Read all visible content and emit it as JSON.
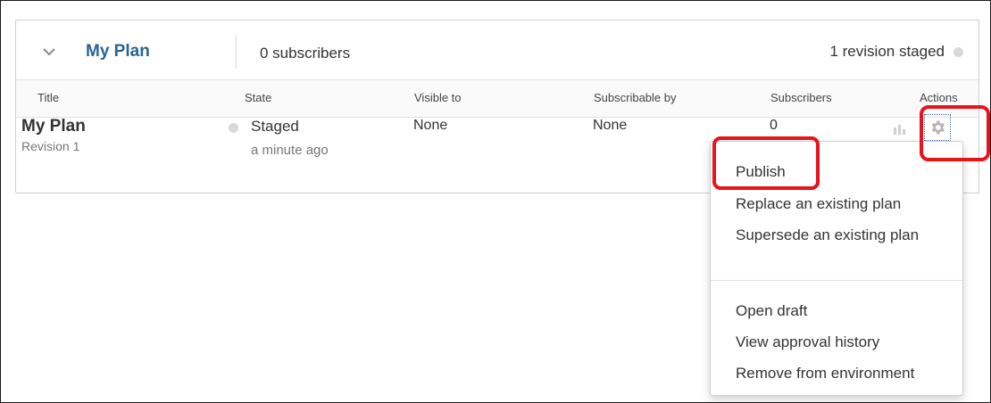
{
  "plan_header": {
    "title": "My Plan",
    "subscribers": "0 subscribers",
    "revision_status": "1 revision staged"
  },
  "table": {
    "columns": [
      "Title",
      "State",
      "Visible to",
      "Subscribable by",
      "Subscribers",
      "Actions"
    ],
    "row": {
      "title": "My Plan",
      "subtitle": "Revision 1",
      "state": "Staged",
      "state_time": "a minute ago",
      "visible_to": "None",
      "subscribable_by": "None",
      "subscribers": "0"
    }
  },
  "actions_menu": {
    "items": [
      "Publish",
      "Replace an existing plan",
      "Supersede an existing plan",
      "Open draft",
      "View approval history",
      "Remove from environment"
    ]
  },
  "icons": [
    "chevron-down-icon",
    "status-dot-icon",
    "bar-chart-icon",
    "gear-icon"
  ],
  "colors": {
    "title_link": "#2a6496",
    "status_dot": "#d9d9d9",
    "highlight": "#e8141b",
    "gear_focus": "#3d6fb6"
  }
}
